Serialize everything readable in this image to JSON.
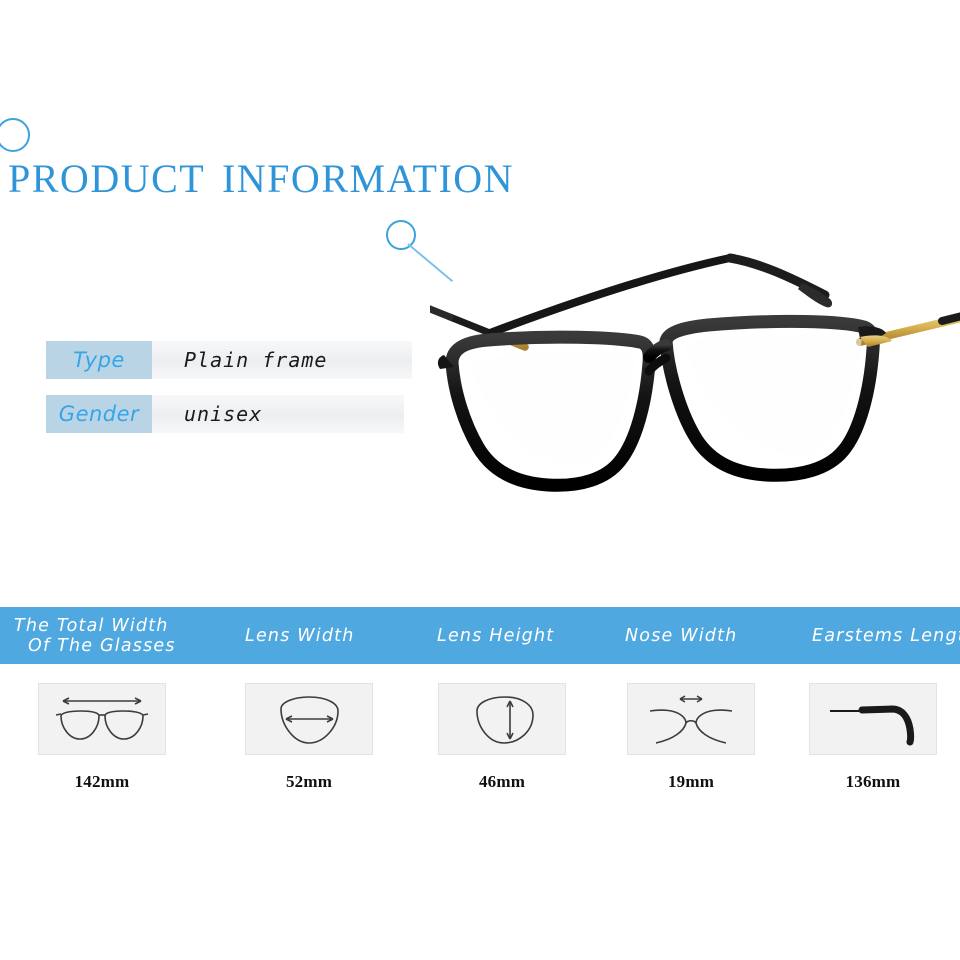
{
  "page": {
    "title": "PRODUCT INFORMATION",
    "background_color": "#ffffff",
    "accent_color": "#4fa8e0",
    "title_color": "#2f95d8"
  },
  "decorations": [
    {
      "name": "circle-top-left",
      "icon": "circle-outline-icon"
    },
    {
      "name": "circle-magnifier",
      "icon": "magnifier-circle-icon"
    }
  ],
  "product_photo": {
    "alt": "black square eyeglass frame with gold temple arms",
    "frame_color": "#111111",
    "temple_color": "#d4af37"
  },
  "specs": [
    {
      "label": "Type",
      "value": "Plain frame"
    },
    {
      "label": "Gender",
      "value": "unisex"
    }
  ],
  "measurements": {
    "columns": [
      {
        "header_line1": "The Total Width",
        "header_line2": "Of The Glasses",
        "icon": "full-glasses-width-icon",
        "value": "142mm"
      },
      {
        "header_line1": "Lens Width",
        "header_line2": "",
        "icon": "lens-width-icon",
        "value": "52mm"
      },
      {
        "header_line1": "Lens Height",
        "header_line2": "",
        "icon": "lens-height-icon",
        "value": "46mm"
      },
      {
        "header_line1": "Nose Width",
        "header_line2": "",
        "icon": "nose-bridge-width-icon",
        "value": "19mm"
      },
      {
        "header_line1": "Earstems Length",
        "header_line2": "",
        "icon": "earstem-length-icon",
        "value": "136mm"
      }
    ]
  }
}
